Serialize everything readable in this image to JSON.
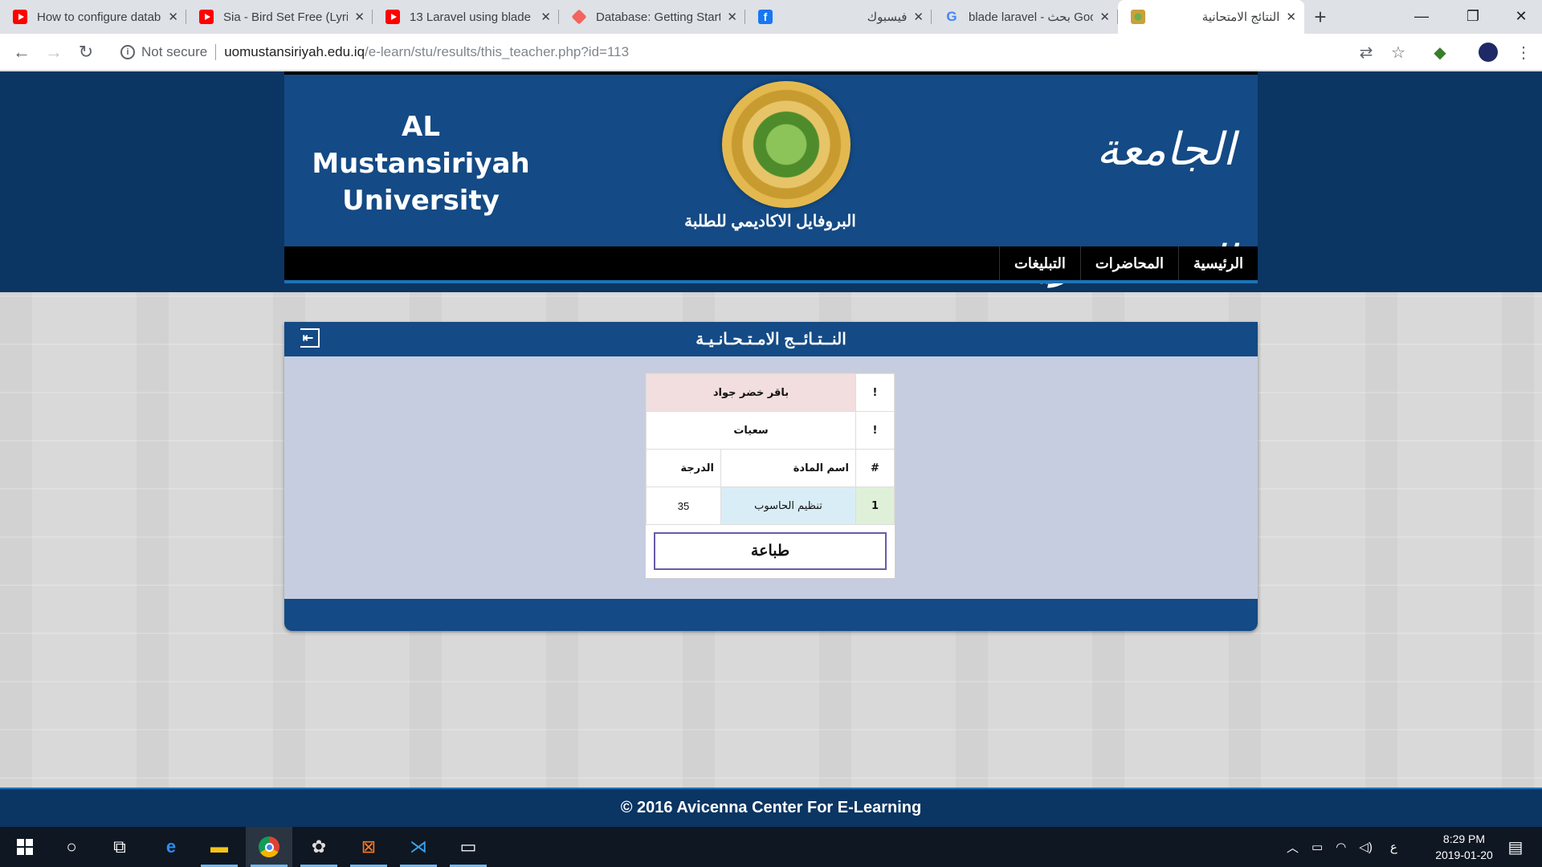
{
  "browser": {
    "tabs": [
      {
        "title": "How to configure datab",
        "favicon": "youtube-icon",
        "rtl": false
      },
      {
        "title": "Sia - Bird Set Free (Lyric",
        "favicon": "youtube-icon",
        "rtl": false
      },
      {
        "title": "13 Laravel using blade",
        "favicon": "youtube-icon",
        "rtl": false
      },
      {
        "title": "Database: Getting Start",
        "favicon": "laravel-icon",
        "rtl": false
      },
      {
        "title": "فيسبوك",
        "favicon": "facebook-icon",
        "rtl": true
      },
      {
        "title": "blade laravel - بحث Goo",
        "favicon": "google-icon",
        "rtl": false
      },
      {
        "title": "النتائج الامتحانية",
        "favicon": "university-icon",
        "rtl": true
      }
    ],
    "security_label": "Not secure",
    "url_host": "uomustansiriyah.edu.iq",
    "url_path": "/e-learn/stu/results/this_teacher.php?id=113"
  },
  "header": {
    "university_en_line1": "AL Mustansiriyah",
    "university_en_line2": "University",
    "profile_label": "البروفايل الاكاديمي للطلبة",
    "calligraphy_text": "الجامعة المستنصرية"
  },
  "nav": {
    "items": [
      "الرئيسية",
      "المحاضرات",
      "التبليغات"
    ]
  },
  "results": {
    "panel_title": "النــتـائــج الامـتـحـانـيـة",
    "student_name": "باقر خضر جواد",
    "section": "سعيات",
    "row_marker": "!",
    "col_index": "#",
    "col_subject": "اسم المادة",
    "col_grade": "الدرجة",
    "rows": [
      {
        "index": "1",
        "subject": "تنظيم الحاسوب",
        "grade": "35"
      }
    ],
    "print_button": "طباعة"
  },
  "footer": {
    "copyright": "© 2016 Avicenna Center For E-Learning"
  },
  "taskbar": {
    "time": "8:29 PM",
    "date": "2019-01-20",
    "input_lang": "ع"
  }
}
